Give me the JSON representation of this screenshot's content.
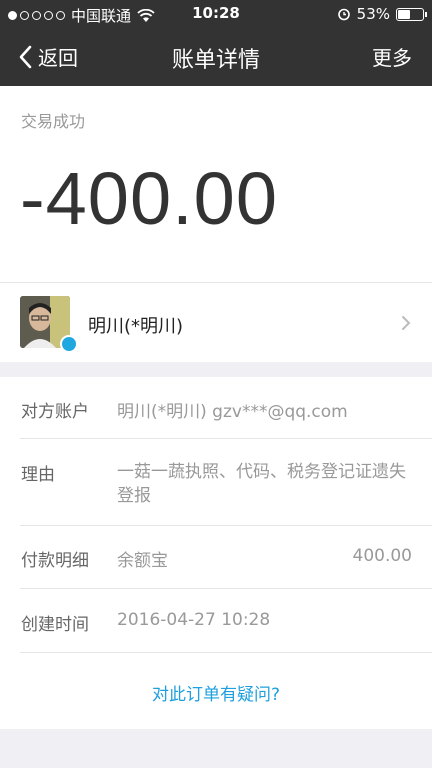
{
  "status_bar": {
    "carrier": "中国联通",
    "time": "10:28",
    "battery_percent": "53%",
    "battery_level": 0.53,
    "signal_bars_filled": 1,
    "signal_bars_total": 5
  },
  "nav": {
    "back_label": "返回",
    "title": "账单详情",
    "more_label": "更多"
  },
  "transaction": {
    "status": "交易成功",
    "amount": "-400.00",
    "counterparty_name": "明川(*明川)"
  },
  "details": {
    "account_label": "对方账户",
    "account_value": "明川(*明川) gzv***@qq.com",
    "reason_label": "理由",
    "reason_value": "一菇一蔬执照、代码、税务登记证遗失登报",
    "payment_label": "付款明细",
    "payment_method": "余额宝",
    "payment_amount": "400.00",
    "created_label": "创建时间",
    "created_value": "2016-04-27 10:28"
  },
  "question_link": "对此订单有疑问?",
  "colors": {
    "bar": "#333333",
    "link": "#1fa0dd",
    "background": "#efeff4"
  }
}
